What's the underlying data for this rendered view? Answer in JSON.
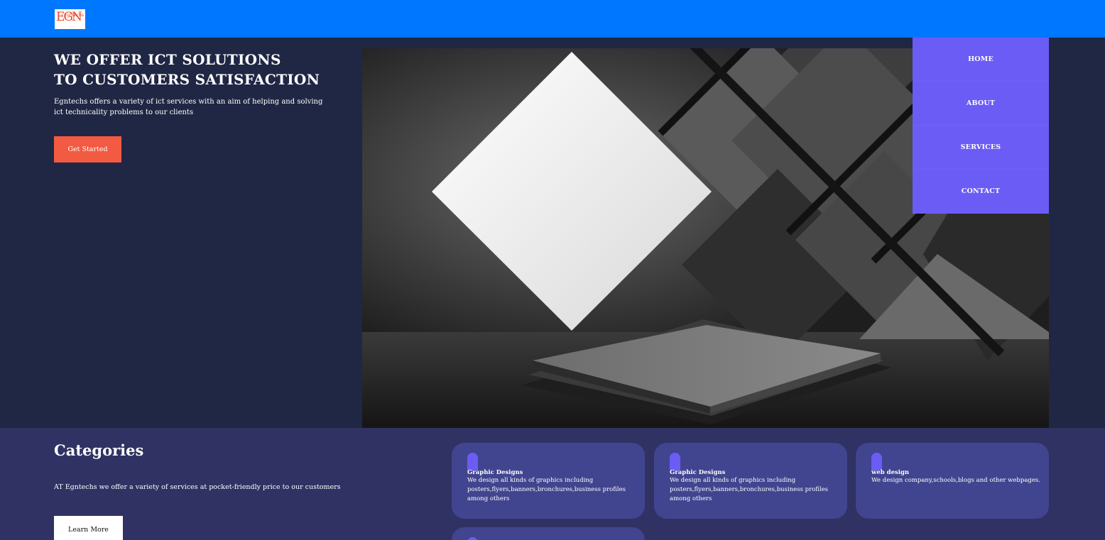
{
  "header": {
    "logo_text": "EGN",
    "logo_small": "Egntechs",
    "bg_color": "#0077ff"
  },
  "hero": {
    "title_line1": "WE OFFER ICT SOLUTIONS",
    "title_line2": "TO CUSTOMERS SATISFACTION",
    "description": "Egntechs offers a variety of ict services with an aim of helping and solving ict technicality problems to our clients",
    "cta_label": "Get Started",
    "cta_color": "#f25a41"
  },
  "nav": {
    "bg_color": "#6b5cf5",
    "items": [
      {
        "label": "HOME"
      },
      {
        "label": "ABOUT"
      },
      {
        "label": "SERVICES"
      },
      {
        "label": "CONTACT"
      }
    ]
  },
  "categories": {
    "title": "Categories",
    "description": "AT Egntechs we offer a variety of services at pocket-friendly price to our customers",
    "button_label": "Learn More",
    "cards": [
      {
        "title": "Graphic Designs",
        "description": "We design all kinds of graphics including posters,flyers,banners,bronchures,business profiles among others",
        "icon": "pill-icon"
      },
      {
        "title": "Graphic Designs",
        "description": "We design all kinds of graphics including posters,flyers,banners,bronchures,business profiles among others",
        "icon": "pill-icon"
      },
      {
        "title": "web design",
        "description": "We design company,schools,blogs and other webpages.",
        "icon": "pill-icon"
      }
    ]
  }
}
